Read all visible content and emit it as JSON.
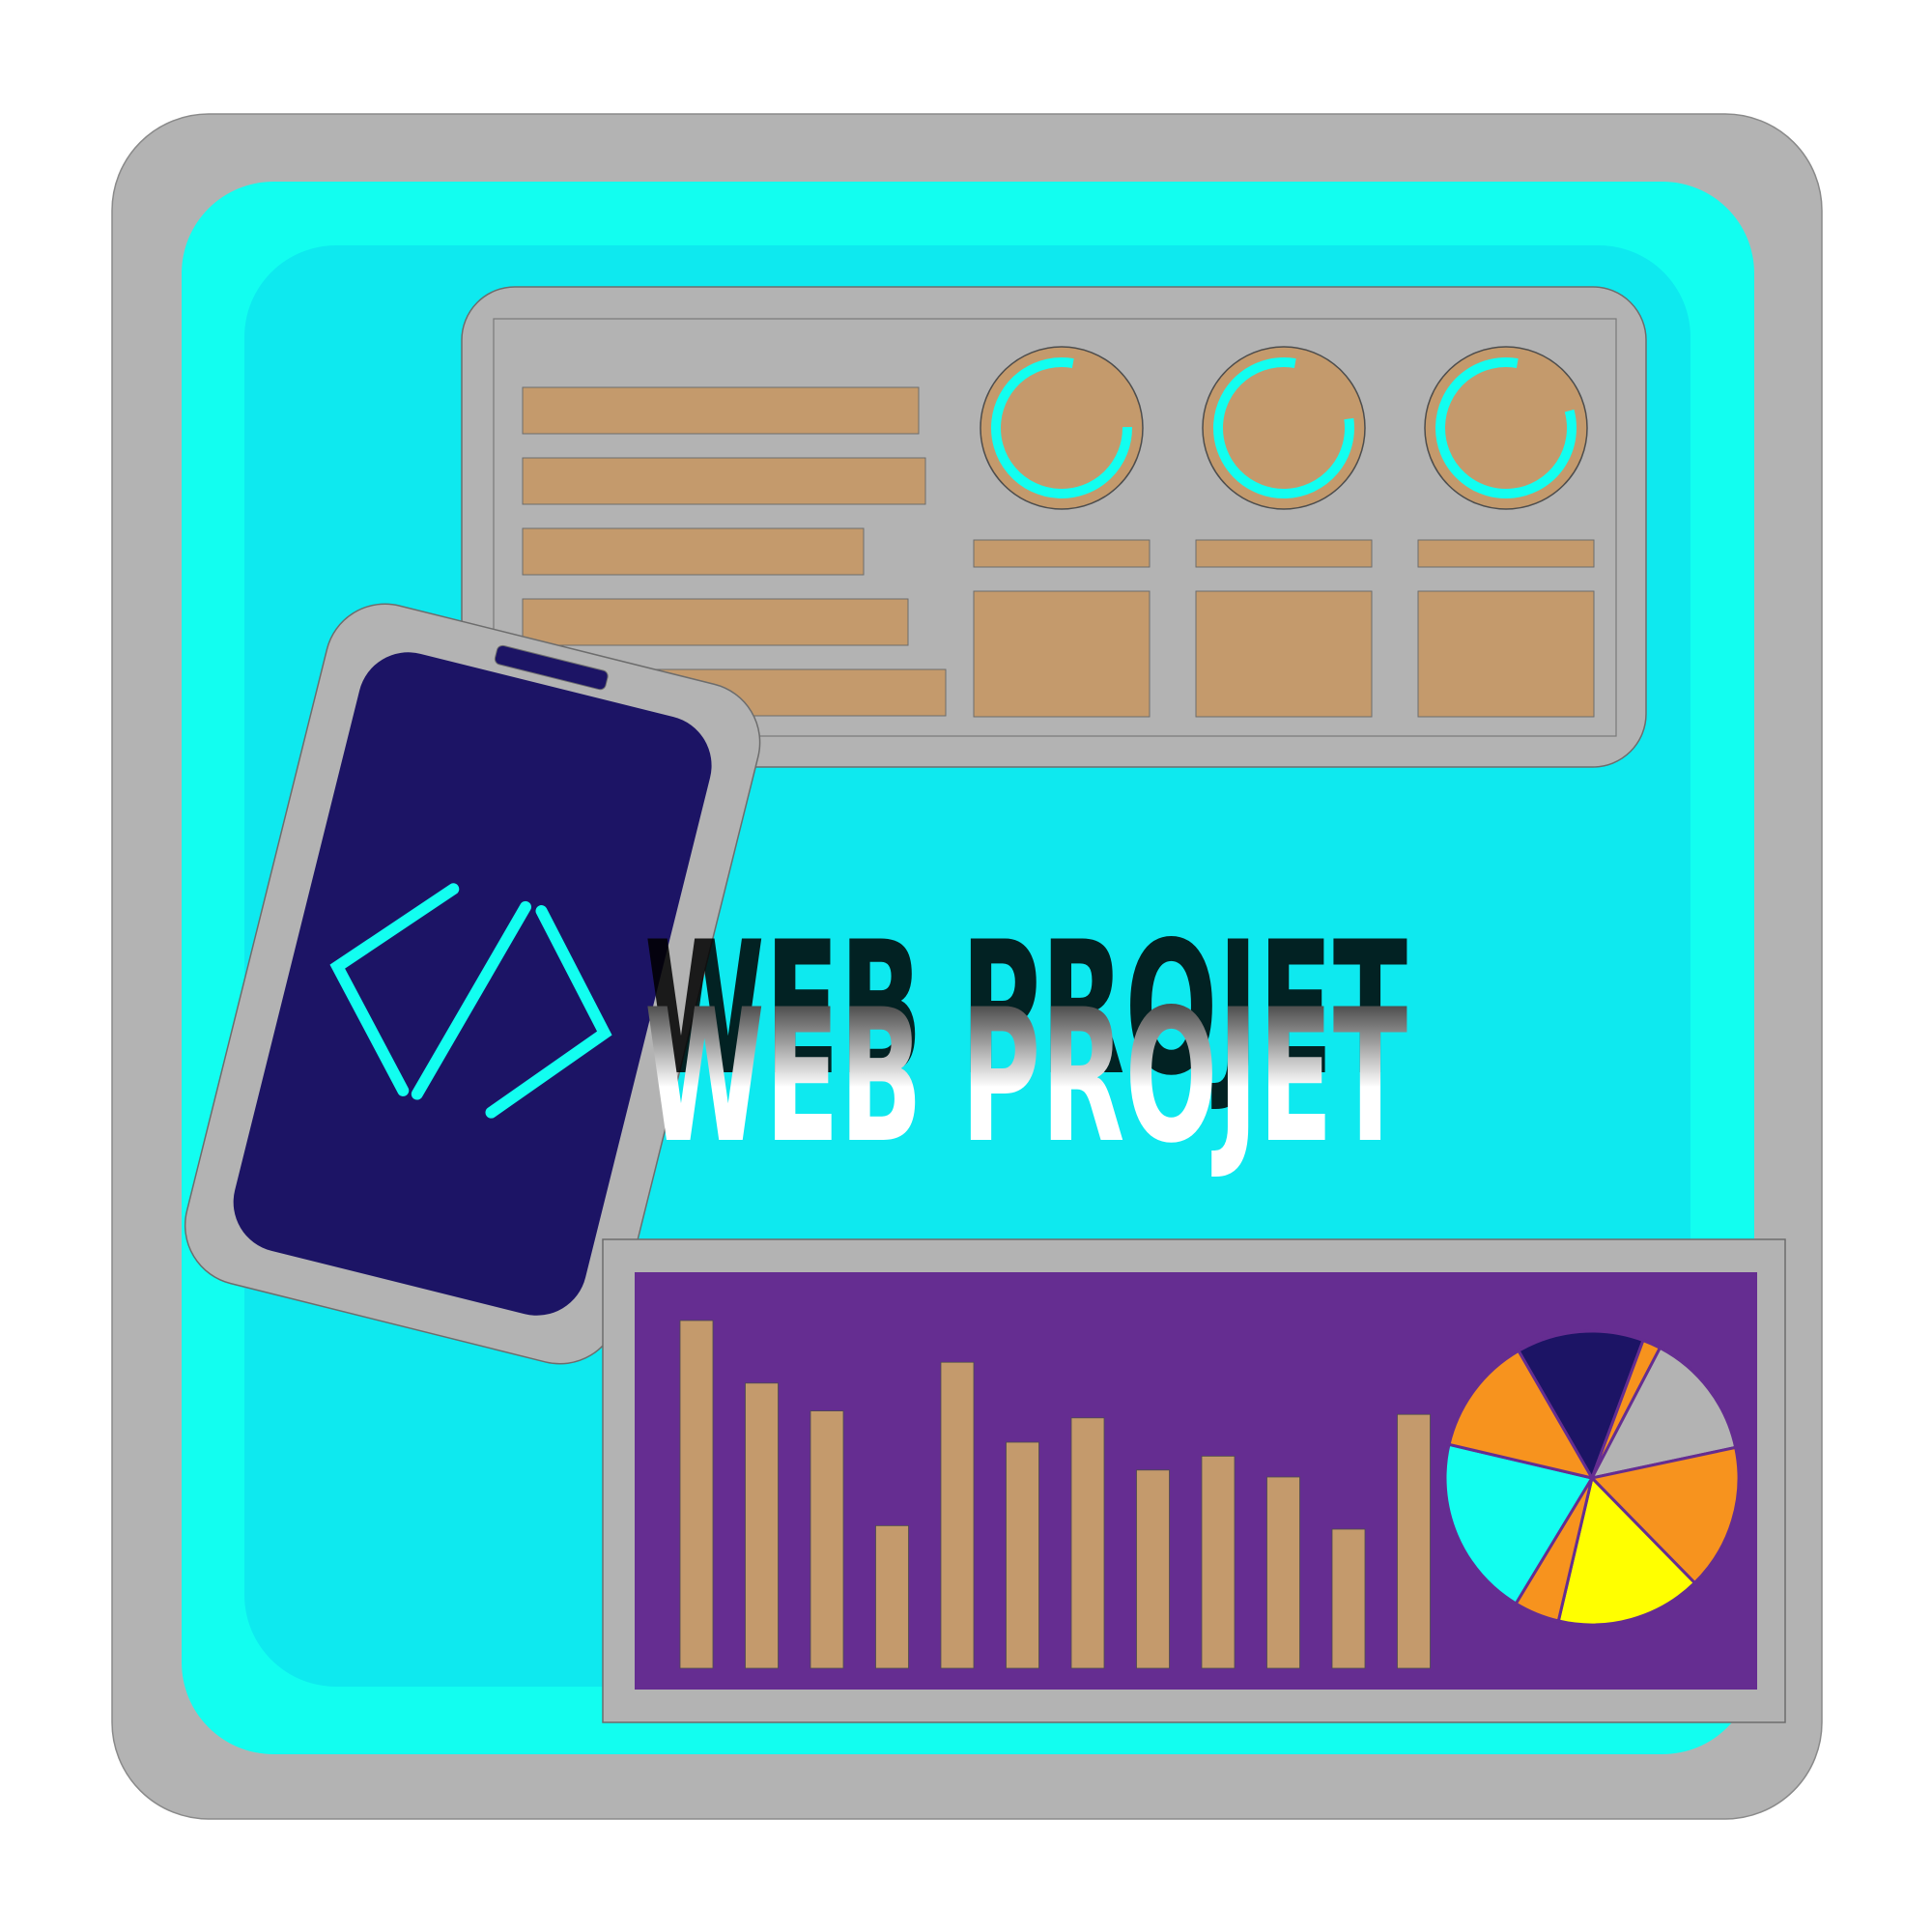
{
  "title": {
    "text": "WEB PROJET"
  },
  "colors": {
    "frame_gray": "#b3b3b3",
    "outer_cyan": "#12fef0",
    "inner_cyan": "#0ee9ef",
    "tan": "#c49a6c",
    "navy": "#1c1465",
    "purple": "#652d91",
    "orange": "#f7931e",
    "yellow": "#ffff00",
    "gauge_ring": "#12fef0"
  },
  "icons": {
    "code": "code-brackets-icon",
    "phone": "mobile-phone-icon"
  },
  "dashboard": {
    "gauges": [
      {
        "name": "gauge-1",
        "level": 0.78
      },
      {
        "name": "gauge-2",
        "level": 0.8
      },
      {
        "name": "gauge-3",
        "level": 0.82
      }
    ]
  },
  "chart_data": [
    {
      "type": "bar",
      "values": [
        100,
        82,
        74,
        41,
        88,
        65,
        72,
        57,
        61,
        55,
        40,
        73
      ]
    },
    {
      "type": "pie",
      "slices": [
        {
          "value": 14,
          "color": "#1c1465"
        },
        {
          "value": 2,
          "color": "#f7931e"
        },
        {
          "value": 14,
          "color": "#b3b3b3"
        },
        {
          "value": 16,
          "color": "#f7931e"
        },
        {
          "value": 16,
          "color": "#ffff00"
        },
        {
          "value": 5,
          "color": "#f7931e"
        },
        {
          "value": 20,
          "color": "#12fef0"
        },
        {
          "value": 13,
          "color": "#f7931e"
        }
      ]
    }
  ]
}
